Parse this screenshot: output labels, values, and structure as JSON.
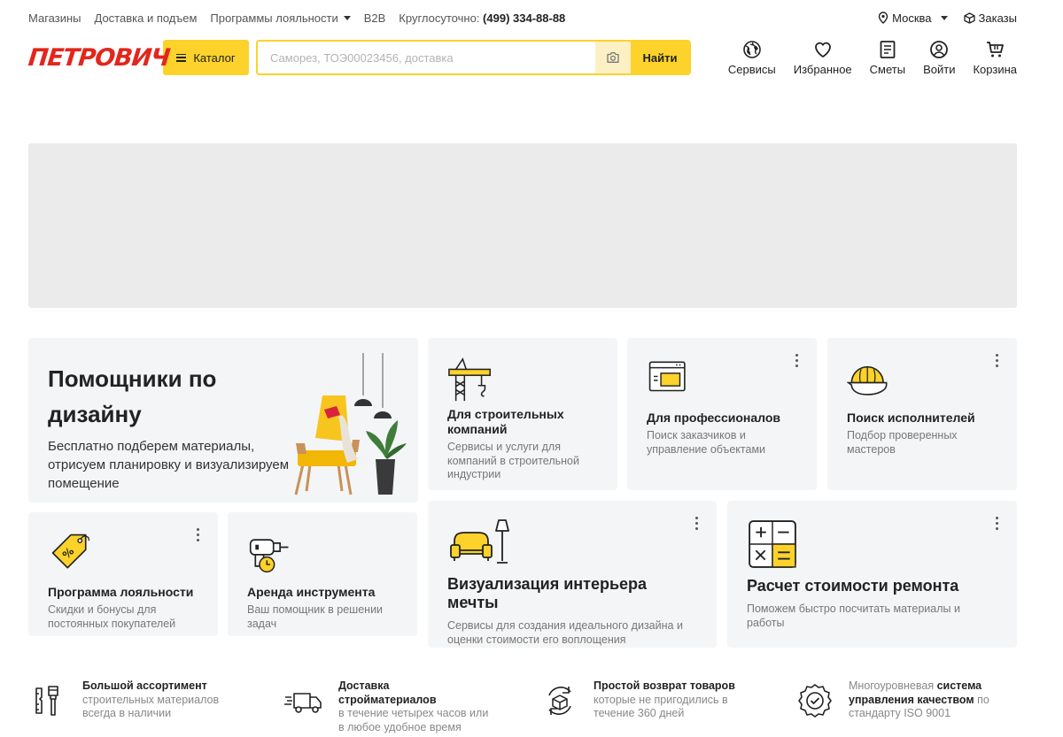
{
  "topbar": {
    "links": [
      "Магазины",
      "Доставка и подъем",
      "Программы лояльности",
      "B2B"
    ],
    "phone_label": "Круглосуточно:",
    "phone": "(499) 334-88-88",
    "city": "Москва",
    "orders": "Заказы"
  },
  "header": {
    "logo": "ПЕТРОВИЧ",
    "catalog": "Каталог",
    "search_placeholder": "Саморез, ТОЭ00023456, доставка",
    "search_value": "",
    "find": "Найти",
    "icons": [
      {
        "label": "Сервисы",
        "icon": "globe-icon"
      },
      {
        "label": "Избранное",
        "icon": "heart-icon"
      },
      {
        "label": "Сметы",
        "icon": "document-icon"
      },
      {
        "label": "Войти",
        "icon": "user-icon"
      },
      {
        "label": "Корзина",
        "icon": "cart-icon"
      }
    ]
  },
  "design_card": {
    "title": "Помощники по дизайну",
    "description": "Бесплатно подберем материалы, отрисуем планировку и визуализируем помещение"
  },
  "cards": {
    "builders": {
      "title": "Для строительных компаний",
      "sub": "Сервисы и услуги для компаний в строительной индустрии",
      "icon": "crane-icon"
    },
    "pros": {
      "title": "Для профессионалов",
      "sub": "Поиск заказчиков и управление объектами",
      "icon": "browser-window-icon"
    },
    "contractors": {
      "title": "Поиск исполнителей",
      "sub": "Подбор проверенных мастеров",
      "icon": "hard-hat-icon"
    },
    "loyalty": {
      "title": "Программа лояльности",
      "sub": "Скидки и бонусы для постоянных покупателей",
      "icon": "price-tag-icon"
    },
    "rental": {
      "title": "Аренда инструмента",
      "sub": "Ваш помощник в решении задач",
      "icon": "drill-icon"
    },
    "interior": {
      "title": "Визуализация интерьера мечты",
      "sub": "Сервисы для создания идеального дизайна и оценки стоимости его воплощения",
      "icon": "armchair-lamp-icon"
    },
    "estimate": {
      "title": "Расчет стоимости ремонта",
      "sub": "Поможем быстро посчитать материалы и работы",
      "icon": "calculator-icon"
    }
  },
  "features": {
    "assortment": {
      "title": "Большой ассортимент",
      "sub": "строительных материалов всегда в наличии"
    },
    "delivery": {
      "title": "Доставка стройматериалов",
      "sub": "в течение четырех часов или в любое удобное время"
    },
    "returns": {
      "title": "Простой возврат товаров",
      "sub": "которые не пригодились в течение 360 дней"
    },
    "quality": {
      "pre": "Многоуровневая ",
      "bold": "система управления качеством",
      "post": " по стандарту ISO 9001"
    }
  },
  "colors": {
    "brand_red": "#e2261d",
    "accent_yellow": "#fcd22b",
    "card_bg": "#f4f5f6"
  }
}
